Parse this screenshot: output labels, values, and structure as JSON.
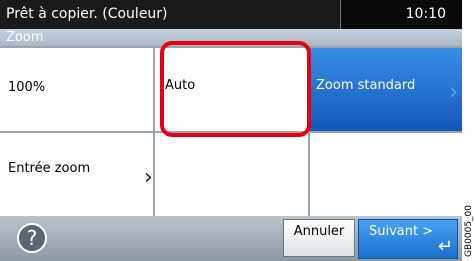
{
  "status": {
    "title": "Prêt à copier. (Couleur)",
    "time": "10:10"
  },
  "header": {
    "title": "Zoom"
  },
  "options": {
    "full": "100%",
    "auto": "Auto",
    "standard": "Zoom standard",
    "entry": "Entrée zoom"
  },
  "footer": {
    "cancel": "Annuler",
    "next": "Suivant >",
    "help": "?"
  },
  "side_code": "GB0005_00",
  "colors": {
    "accent": "#1a6fd0",
    "highlight": "#e60012"
  }
}
